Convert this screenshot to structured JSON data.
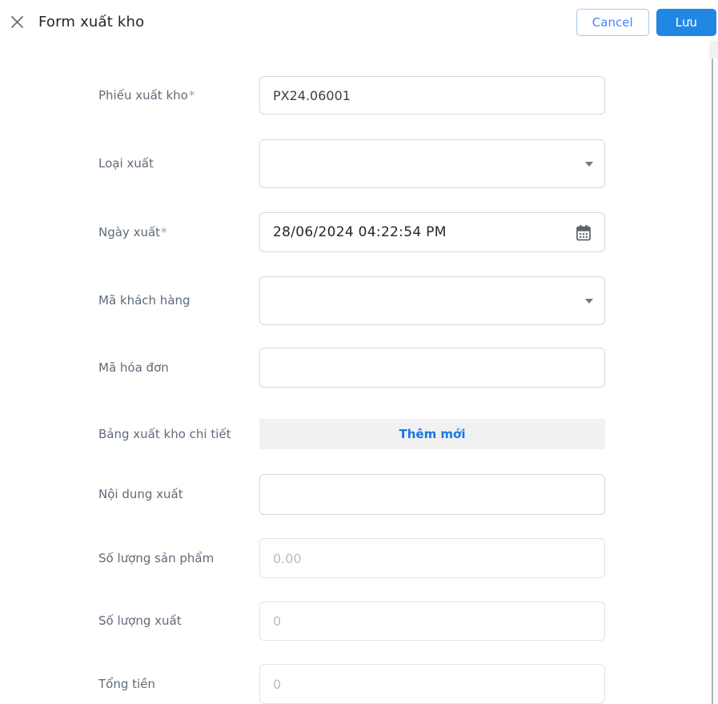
{
  "header": {
    "title": "Form xuất kho",
    "cancel_label": "Cancel",
    "save_label": "Lưu"
  },
  "form": {
    "required_marker": "*",
    "fields": [
      {
        "label": "Phiếu xuất kho",
        "required": true,
        "type": "text",
        "value": "PX24.06001"
      },
      {
        "label": "Loại xuất",
        "required": false,
        "type": "select",
        "value": ""
      },
      {
        "label": "Ngày xuất",
        "required": true,
        "type": "datetime",
        "value": "28/06/2024 04:22:54 PM"
      },
      {
        "label": "Mã khách hàng",
        "required": false,
        "type": "select",
        "value": ""
      },
      {
        "label": "Mã hóa đơn",
        "required": false,
        "type": "text",
        "value": ""
      },
      {
        "label": "Bảng xuất kho chi tiết",
        "required": false,
        "type": "button",
        "button_label": "Thêm mới"
      },
      {
        "label": "Nội dung xuất",
        "required": false,
        "type": "text",
        "value": ""
      },
      {
        "label": "Số lượng sản phẩm",
        "required": false,
        "type": "number",
        "placeholder": "0.00"
      },
      {
        "label": "Số lượng xuất",
        "required": false,
        "type": "number",
        "placeholder": "0"
      },
      {
        "label": "Tổng tiền",
        "required": false,
        "type": "number",
        "placeholder": "0"
      }
    ]
  },
  "colors": {
    "primary_button": "#2187e4",
    "link_blue": "#1b76e3",
    "label_gray": "#5f6b79"
  },
  "icons": {
    "close": "close-icon",
    "calendar": "calendar-icon",
    "caret_down": "chevron-down-icon"
  }
}
